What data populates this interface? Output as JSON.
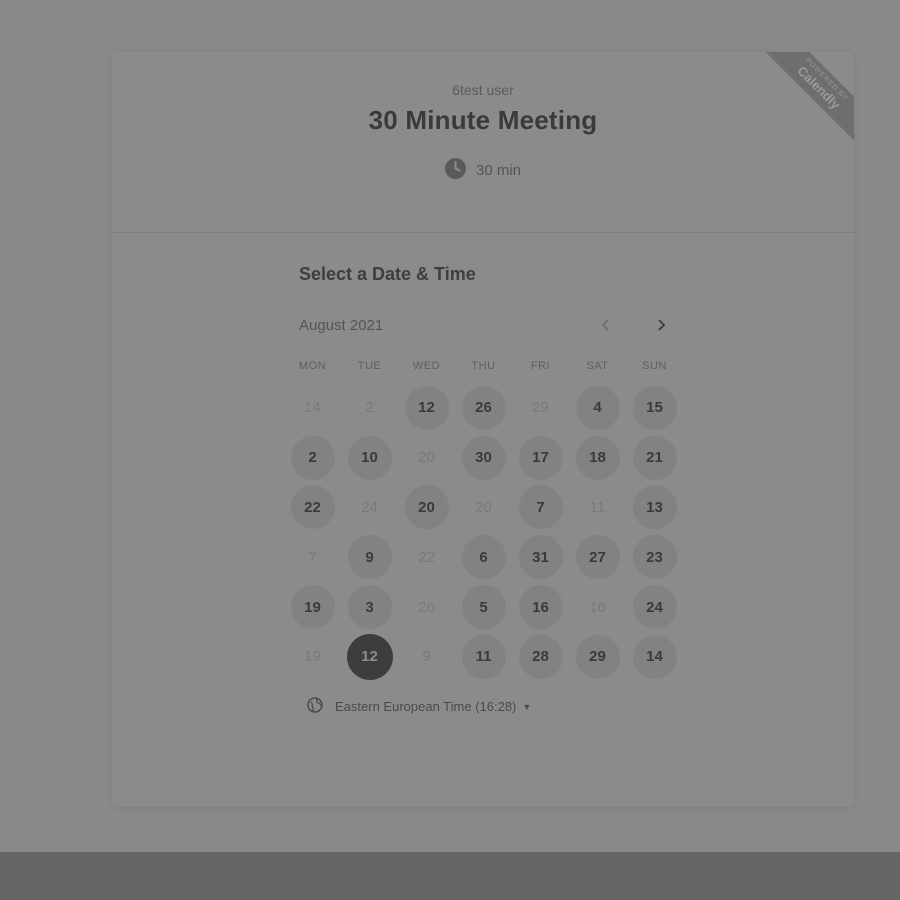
{
  "event": {
    "owner": "6test user",
    "title": "30 Minute Meeting",
    "duration": "30 min"
  },
  "badge": {
    "line1": "POWERED BY",
    "line2": "Calendly"
  },
  "calendar": {
    "section_title": "Select a Date & Time",
    "month_label": "August 2021",
    "weekdays": [
      "MON",
      "TUE",
      "WED",
      "THU",
      "FRI",
      "SAT",
      "SUN"
    ],
    "weeks": [
      [
        {
          "d": "14",
          "a": false
        },
        {
          "d": "2",
          "a": false
        },
        {
          "d": "12",
          "a": true
        },
        {
          "d": "26",
          "a": true
        },
        {
          "d": "29",
          "a": false
        },
        {
          "d": "4",
          "a": true
        },
        {
          "d": "15",
          "a": true
        }
      ],
      [
        {
          "d": "2",
          "a": true
        },
        {
          "d": "10",
          "a": true
        },
        {
          "d": "20",
          "a": false
        },
        {
          "d": "30",
          "a": true
        },
        {
          "d": "17",
          "a": true
        },
        {
          "d": "18",
          "a": true
        },
        {
          "d": "21",
          "a": true
        }
      ],
      [
        {
          "d": "22",
          "a": true
        },
        {
          "d": "24",
          "a": false
        },
        {
          "d": "20",
          "a": true
        },
        {
          "d": "20",
          "a": false
        },
        {
          "d": "7",
          "a": true
        },
        {
          "d": "11",
          "a": false
        },
        {
          "d": "13",
          "a": true
        }
      ],
      [
        {
          "d": "7",
          "a": false
        },
        {
          "d": "9",
          "a": true
        },
        {
          "d": "22",
          "a": false
        },
        {
          "d": "6",
          "a": true
        },
        {
          "d": "31",
          "a": true
        },
        {
          "d": "27",
          "a": true
        },
        {
          "d": "23",
          "a": true
        }
      ],
      [
        {
          "d": "19",
          "a": true
        },
        {
          "d": "3",
          "a": true
        },
        {
          "d": "26",
          "a": false
        },
        {
          "d": "5",
          "a": true
        },
        {
          "d": "16",
          "a": true
        },
        {
          "d": "16",
          "a": false
        },
        {
          "d": "24",
          "a": true
        }
      ],
      [
        {
          "d": "19",
          "a": false
        },
        {
          "d": "12",
          "a": true,
          "s": true
        },
        {
          "d": "9",
          "a": false
        },
        {
          "d": "11",
          "a": true
        },
        {
          "d": "28",
          "a": true
        },
        {
          "d": "29",
          "a": true
        },
        {
          "d": "14",
          "a": true
        }
      ]
    ]
  },
  "timezone": {
    "label": "Eastern European Time (16:28)"
  },
  "icons": {
    "clock": "clock-icon",
    "globe": "globe-icon",
    "prev": "chevron-left-icon",
    "next": "chevron-right-icon",
    "caret": "caret-down-icon"
  },
  "colors": {
    "selected_day": "#3d3d3d",
    "available_day": "#828282",
    "ribbon": "#6e6e6e"
  }
}
